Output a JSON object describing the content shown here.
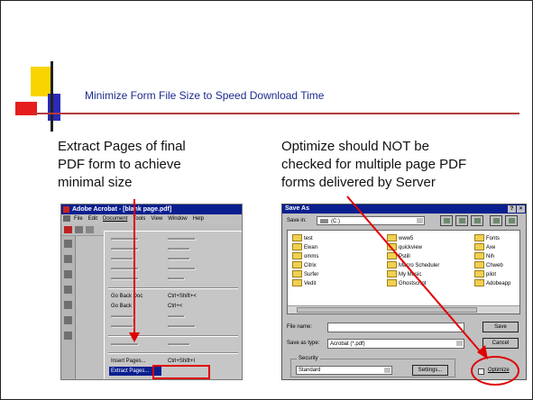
{
  "slide": {
    "title": "Minimize Form File Size to Speed Download Time",
    "left_text": [
      "Extract Pages of final",
      "PDF form to achieve",
      "minimal size"
    ],
    "right_text": [
      "Optimize should NOT be",
      "checked for multiple page PDF",
      "forms delivered by Server"
    ]
  },
  "acrobat": {
    "window_title": "Adobe Acrobat - [blank page.pdf]",
    "menus": [
      "File",
      "Edit",
      "Document",
      "Tools",
      "View",
      "Window",
      "Help"
    ],
    "doc_menu": {
      "go_back_doc": "Go Back Doc",
      "go_back_doc_shortcut": "Ctrl+Shift+<",
      "go_back": "Go Back",
      "go_back_shortcut": "Ctrl+<",
      "insert_pages": "Insert Pages...",
      "insert_pages_shortcut": "Ctrl+Shift+I",
      "extract_pages": "Extract Pages..."
    }
  },
  "save_as": {
    "title": "Save As",
    "help_glyph": "?",
    "close_glyph": "×",
    "save_in_label": "Save in:",
    "save_in_value": "(C:)",
    "folders_col1": [
      "test",
      "Ewan",
      "omms",
      "Citrix",
      "Surfer",
      "Vedit"
    ],
    "folders_col2": [
      "www5",
      "quickview",
      "Pstill",
      "Macro Scheduler",
      "My Music",
      "Ghostscript"
    ],
    "folders_col3": [
      "Fonts",
      "Axe",
      "Nih",
      "Chweb",
      "pilot",
      "Adobeapp"
    ],
    "file_name_label": "File name:",
    "file_name_value": "",
    "save_as_type_label": "Save as type:",
    "save_as_type_value": "Acrobat (*.pdf)",
    "save_button": "Save",
    "cancel_button": "Cancel",
    "security_label": "Security",
    "security_value": "Standard",
    "settings_button": "Settings...",
    "optimize_label": "Optimize",
    "optimize_checked": false
  },
  "colors": {
    "title_blue": "#1b2a8c",
    "accent_red": "#e00000",
    "window_blue": "#0a1f8f"
  }
}
